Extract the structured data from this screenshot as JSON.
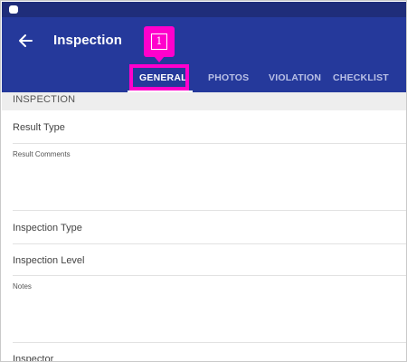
{
  "app": {
    "title": "Inspection"
  },
  "tabs": [
    {
      "label": "GENERAL",
      "active": true
    },
    {
      "label": "PHOTOS",
      "active": false
    },
    {
      "label": "VIOLATION",
      "active": false
    },
    {
      "label": "CHECKLIST",
      "active": false
    }
  ],
  "marker": {
    "label": "1",
    "color": "#ff00cc"
  },
  "section": {
    "title": "INSPECTION"
  },
  "fields": {
    "result_type": "Result Type",
    "result_comments": "Result Comments",
    "inspection_type": "Inspection Type",
    "inspection_level": "Inspection Level",
    "notes": "Notes",
    "inspector": "Inspector"
  },
  "colors": {
    "appbar": "#25399b",
    "statusbar": "#1f2d7a",
    "highlight": "#ff00cc"
  },
  "icons": {
    "back": "back-arrow-icon",
    "status": "notification-icon"
  }
}
